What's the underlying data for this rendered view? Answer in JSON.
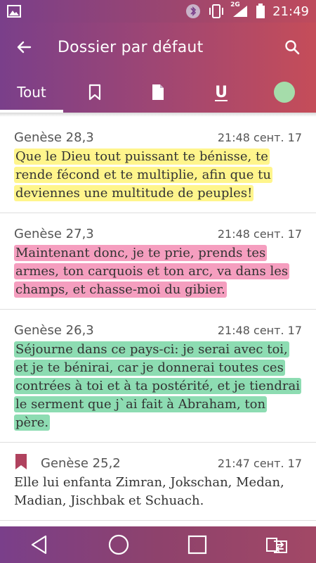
{
  "status_bar": {
    "network_label": "2G",
    "time": "21:49"
  },
  "app_bar": {
    "title": "Dossier par défaut",
    "tabs": [
      {
        "label": "Tout",
        "icon": null,
        "active": true
      },
      {
        "label": "",
        "icon": "bookmark-icon",
        "active": false
      },
      {
        "label": "",
        "icon": "note-icon",
        "active": false
      },
      {
        "label": "U",
        "icon": "underline-icon",
        "active": false
      },
      {
        "label": "",
        "icon": "highlight-color-icon",
        "active": false
      }
    ],
    "tab0": "Tout",
    "tab3": "U"
  },
  "colors": {
    "bar_gradient_start": "#7a3f8a",
    "bar_gradient_end": "#c54d59",
    "highlight_yellow": "#fff58c",
    "highlight_pink": "#f59ebf",
    "highlight_green": "#8ddcb2",
    "bookmark": "#b0425e",
    "tab_dot": "#a5dcaa"
  },
  "items": [
    {
      "ref": "Genèse 28,3",
      "time": "21:48 сент. 17",
      "text": "Que le Dieu tout puissant te bénisse, te rende fécond et te multiplie, afin que tu deviennes une multitude de peuples!",
      "highlight": "yellow",
      "bookmark": false
    },
    {
      "ref": "Genèse 27,3",
      "time": "21:48 сент. 17",
      "text": "Maintenant donc, je te prie, prends tes armes, ton carquois et ton arc, va dans les champs, et chasse-moi du gibier.",
      "highlight": "pink",
      "bookmark": false
    },
    {
      "ref": "Genèse 26,3",
      "time": "21:48 сент. 17",
      "text": "Séjourne dans ce pays-ci: je serai avec toi, et je te bénirai, car je donnerai toutes ces contrées à toi et à ta postérité, et je tiendrai le serment que j`ai fait à Abraham, ton père.",
      "highlight": "green",
      "bookmark": false
    },
    {
      "ref": "Genèse 25,2",
      "time": "21:47 сент. 17",
      "text": "Elle lui enfanta Zimran, Jokschan, Medan, Madian, Jischbak et Schuach.",
      "highlight": "none",
      "bookmark": true
    }
  ]
}
